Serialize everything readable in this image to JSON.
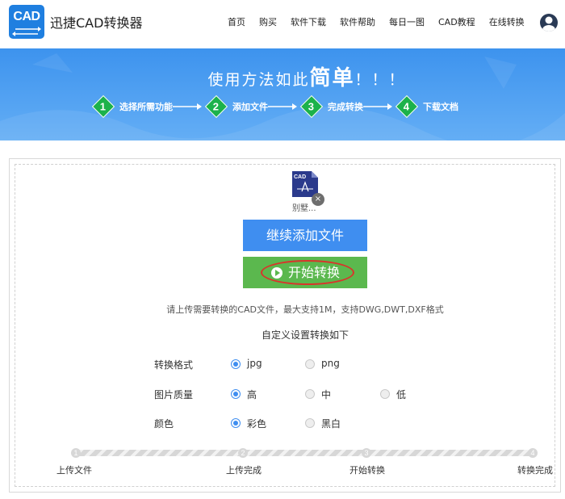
{
  "header": {
    "logo_text": "CAD",
    "brand": "迅捷CAD转换器",
    "nav": [
      "首页",
      "购买",
      "软件下载",
      "软件帮助",
      "每日一图",
      "CAD教程",
      "在线转换"
    ]
  },
  "banner": {
    "title_prefix": "使用方法如此",
    "title_emphasis": "简单",
    "title_suffix": "！！！",
    "steps": [
      {
        "num": "1",
        "label": "选择所需功能"
      },
      {
        "num": "2",
        "label": "添加文件"
      },
      {
        "num": "3",
        "label": "完成转换"
      },
      {
        "num": "4",
        "label": "下载文档"
      }
    ]
  },
  "file": {
    "icon_text": "CAD",
    "name": "别墅..."
  },
  "buttons": {
    "add": "继续添加文件",
    "start": "开始转换"
  },
  "hint": "请上传需要转换的CAD文件，最大支持1M，支持DWG,DWT,DXF格式",
  "settings_title": "自定义设置转换如下",
  "options": [
    {
      "label": "转换格式",
      "choices": [
        "jpg",
        "png"
      ],
      "selected": 0
    },
    {
      "label": "图片质量",
      "choices": [
        "高",
        "中",
        "低"
      ],
      "selected": 0
    },
    {
      "label": "颜色",
      "choices": [
        "彩色",
        "黑白"
      ],
      "selected": 0
    }
  ],
  "progress": {
    "steps": [
      {
        "num": "1",
        "label": "上传文件"
      },
      {
        "num": "2",
        "label": "上传完成"
      },
      {
        "num": "3",
        "label": "开始转换"
      },
      {
        "num": "4",
        "label": "转换完成"
      }
    ]
  },
  "colors": {
    "accent_blue": "#3f8ef0",
    "start_green": "#5bb84e",
    "step_green": "#1cb24b",
    "highlight_red": "#d9342b"
  }
}
